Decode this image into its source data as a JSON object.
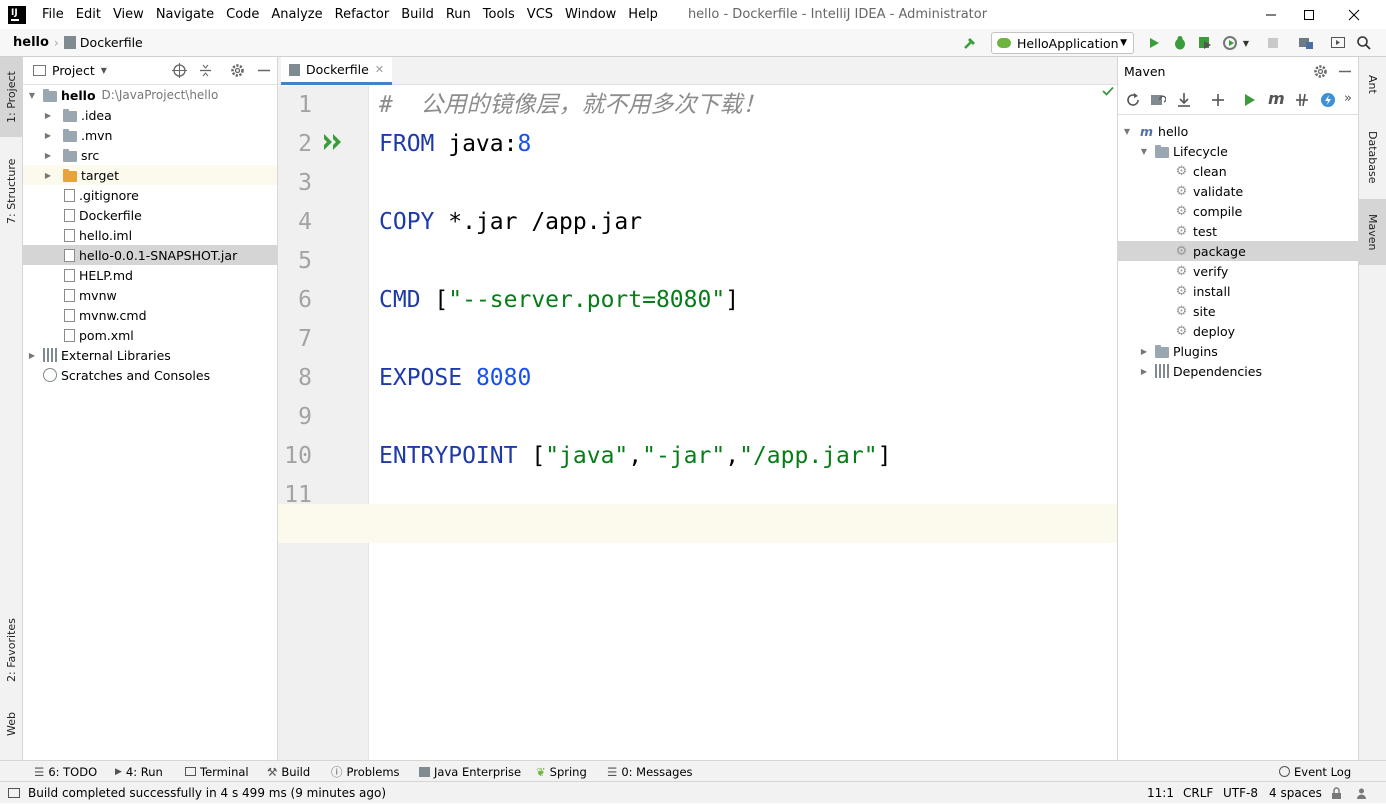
{
  "window": {
    "title": "hello - Dockerfile - IntelliJ IDEA - Administrator",
    "menu": [
      "File",
      "Edit",
      "View",
      "Navigate",
      "Code",
      "Analyze",
      "Refactor",
      "Build",
      "Run",
      "Tools",
      "VCS",
      "Window",
      "Help"
    ]
  },
  "navbar": {
    "project": "hello",
    "file": "Dockerfile",
    "run_config": "HelloApplication"
  },
  "left_stripe": {
    "project_tab": "1: Project",
    "structure_tab": "7: Structure",
    "favorites_tab": "2: Favorites",
    "web_tab": "Web"
  },
  "right_stripe": {
    "ant_tab": "Ant",
    "database_tab": "Database",
    "maven_tab": "Maven"
  },
  "project_panel": {
    "title": "Project",
    "root_name": "hello",
    "root_path": "D:\\JavaProject\\hello",
    "items": [
      {
        "label": ".idea",
        "kind": "folder"
      },
      {
        "label": ".mvn",
        "kind": "folder"
      },
      {
        "label": "src",
        "kind": "folder"
      },
      {
        "label": "target",
        "kind": "folder-orange"
      },
      {
        "label": ".gitignore",
        "kind": "file"
      },
      {
        "label": "Dockerfile",
        "kind": "file"
      },
      {
        "label": "hello.iml",
        "kind": "file"
      },
      {
        "label": "hello-0.0.1-SNAPSHOT.jar",
        "kind": "file"
      },
      {
        "label": "HELP.md",
        "kind": "file"
      },
      {
        "label": "mvnw",
        "kind": "file"
      },
      {
        "label": "mvnw.cmd",
        "kind": "file"
      },
      {
        "label": "pom.xml",
        "kind": "file"
      }
    ],
    "external_libraries": "External Libraries",
    "scratches": "Scratches and Consoles"
  },
  "editor": {
    "tab": "Dockerfile",
    "line_numbers": [
      "1",
      "2",
      "3",
      "4",
      "5",
      "6",
      "7",
      "8",
      "9",
      "10",
      "11"
    ],
    "lines": {
      "l1_comment": "#  公用的镜像层，就不用多次下载！",
      "l2_kw": "FROM",
      "l2_text": " java:",
      "l2_num": "8",
      "l4_kw": "COPY",
      "l4_text": " *.jar /app.jar",
      "l6_kw": "CMD",
      "l6_open": " [",
      "l6_str": "\"--server.port=8080\"",
      "l6_close": "]",
      "l8_kw": "EXPOSE",
      "l8_num": " 8080",
      "l10_kw": "ENTRYPOINT",
      "l10_open": " [",
      "l10_s1": "\"java\"",
      "l10_c1": ",",
      "l10_s2": "\"-jar\"",
      "l10_c2": ",",
      "l10_s3": "\"/app.jar\"",
      "l10_close": "]"
    }
  },
  "maven_panel": {
    "title": "Maven",
    "project": "hello",
    "lifecycle": "Lifecycle",
    "phases": [
      "clean",
      "validate",
      "compile",
      "test",
      "package",
      "verify",
      "install",
      "site",
      "deploy"
    ],
    "selected_phase": "package",
    "plugins": "Plugins",
    "dependencies": "Dependencies"
  },
  "bottom_tools": {
    "todo": "6: TODO",
    "run": "4: Run",
    "terminal": "Terminal",
    "build": "Build",
    "problems": "Problems",
    "java_enterprise": "Java Enterprise",
    "spring": "Spring",
    "messages": "0: Messages",
    "event_log": "Event Log"
  },
  "status": {
    "message": "Build completed successfully in 4 s 499 ms (9 minutes ago)",
    "position": "11:1",
    "line_sep": "CRLF",
    "encoding": "UTF-8",
    "indent": "4 spaces"
  },
  "colors": {
    "keyword": "#1f3aa8",
    "string": "#067d17",
    "number": "#1750eb",
    "selection": "#d5d5d5",
    "run_green": "#3a9c3a"
  }
}
